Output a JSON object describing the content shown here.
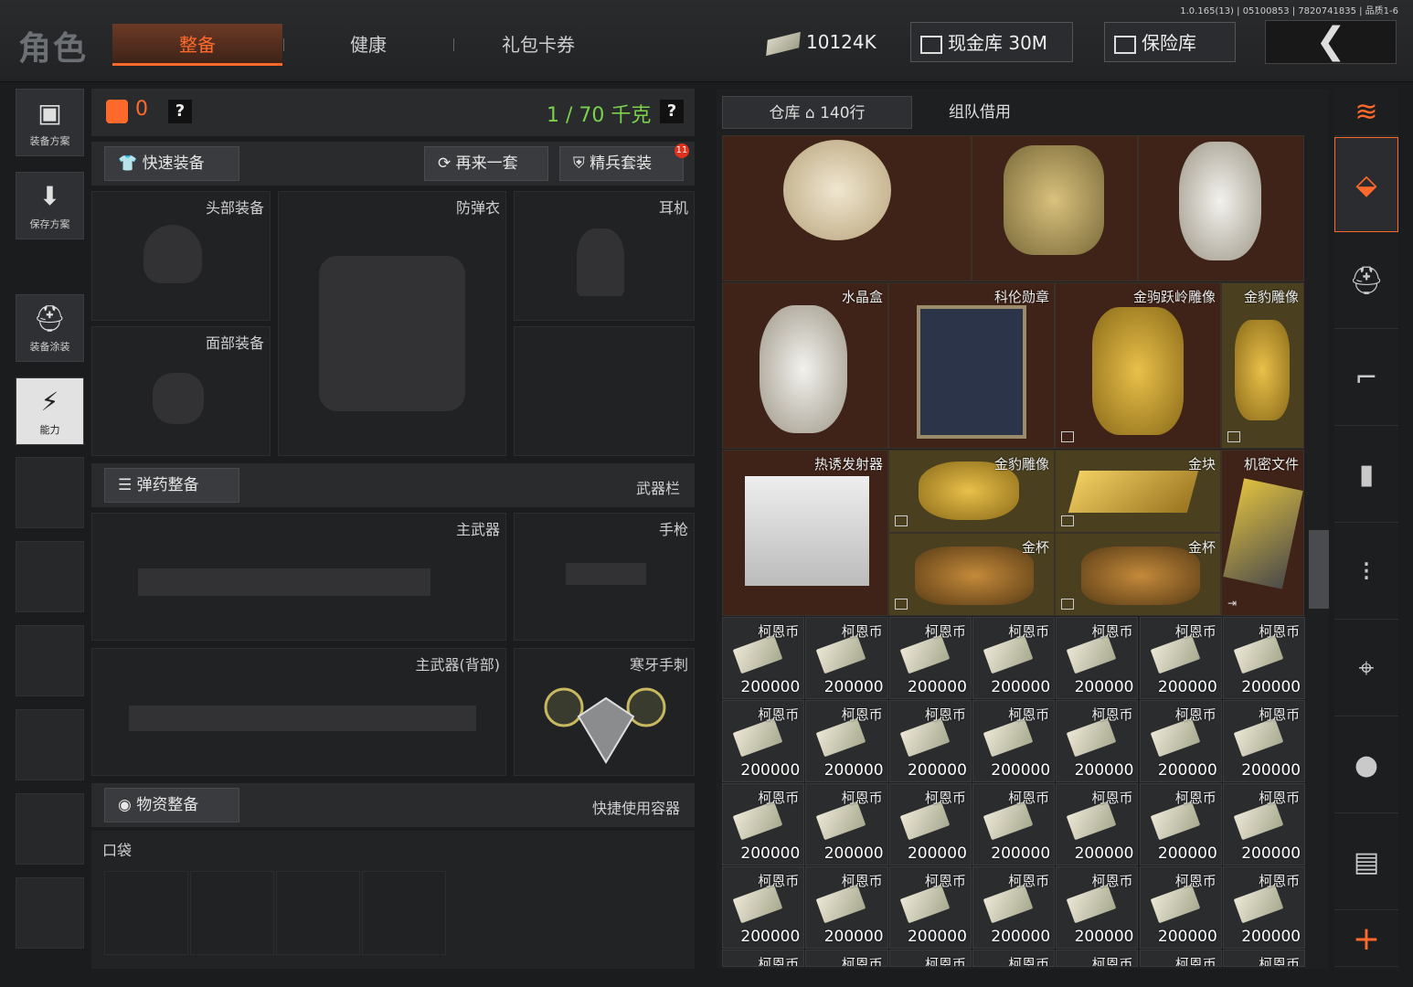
{
  "version": "1.0.165(13) | 05100853 | 7820741835 | 品质1-6",
  "header": {
    "title": "角色",
    "tabs": [
      {
        "label": "整备",
        "active": true
      },
      {
        "label": "健康",
        "active": false
      },
      {
        "label": "礼包卡券",
        "active": false
      }
    ],
    "currency": "10124K",
    "cash_vault": "现金库 30M",
    "safe": "保险库",
    "back": "❮"
  },
  "left_sidebar": [
    {
      "label": "装备方案",
      "icon": "vest-icon"
    },
    {
      "label": "保存方案",
      "icon": "download-icon"
    },
    {
      "label": "装备涂装",
      "icon": "helmet-paint-icon"
    },
    {
      "label": "能力",
      "icon": "ability-icon",
      "active": true
    }
  ],
  "loadout": {
    "backpack_count": "0",
    "help": "?",
    "weight": "1 / 70 千克",
    "quick_equip": "快速装备",
    "again": "再来一套",
    "elite": "精兵套装",
    "elite_badge": "11",
    "slots": {
      "head": "头部装备",
      "armor": "防弹衣",
      "headset": "耳机",
      "face": "面部装备"
    },
    "ammo_section": "弹药整备",
    "weapon_bar": "武器栏",
    "weapons": {
      "primary": "主武器",
      "pistol": "手枪",
      "primary_back": "主武器(背部)",
      "melee": "寒牙手刺"
    },
    "supply_section": "物资整备",
    "quick_container": "快捷使用容器",
    "pocket": "口袋"
  },
  "warehouse": {
    "tab_storage": "仓库",
    "rows": "140行",
    "tab_team": "组队借用",
    "items": [
      {
        "name": "水晶盒"
      },
      {
        "name": "科伦勋章"
      },
      {
        "name": "金驹跃岭雕像"
      },
      {
        "name": "金豹雕像"
      },
      {
        "name": "热诱发射器"
      },
      {
        "name": "金豹雕像"
      },
      {
        "name": "金块"
      },
      {
        "name": "机密文件"
      },
      {
        "name": "金杯"
      },
      {
        "name": "金杯"
      }
    ],
    "coin_name": "柯恩币",
    "coin_qty": "200000"
  },
  "right_rail": [
    "all-categories-icon",
    "storage-icon",
    "helmet-icon",
    "rifle-icon",
    "magazine-icon",
    "ammo-icon",
    "scope-icon",
    "grenade-icon",
    "container-icon",
    "plus-icon"
  ],
  "colors": {
    "accent": "#ff6a2c",
    "weight_green": "#7bd14b",
    "brown_cell": "#3f2318",
    "olive_cell": "#4a4020"
  }
}
